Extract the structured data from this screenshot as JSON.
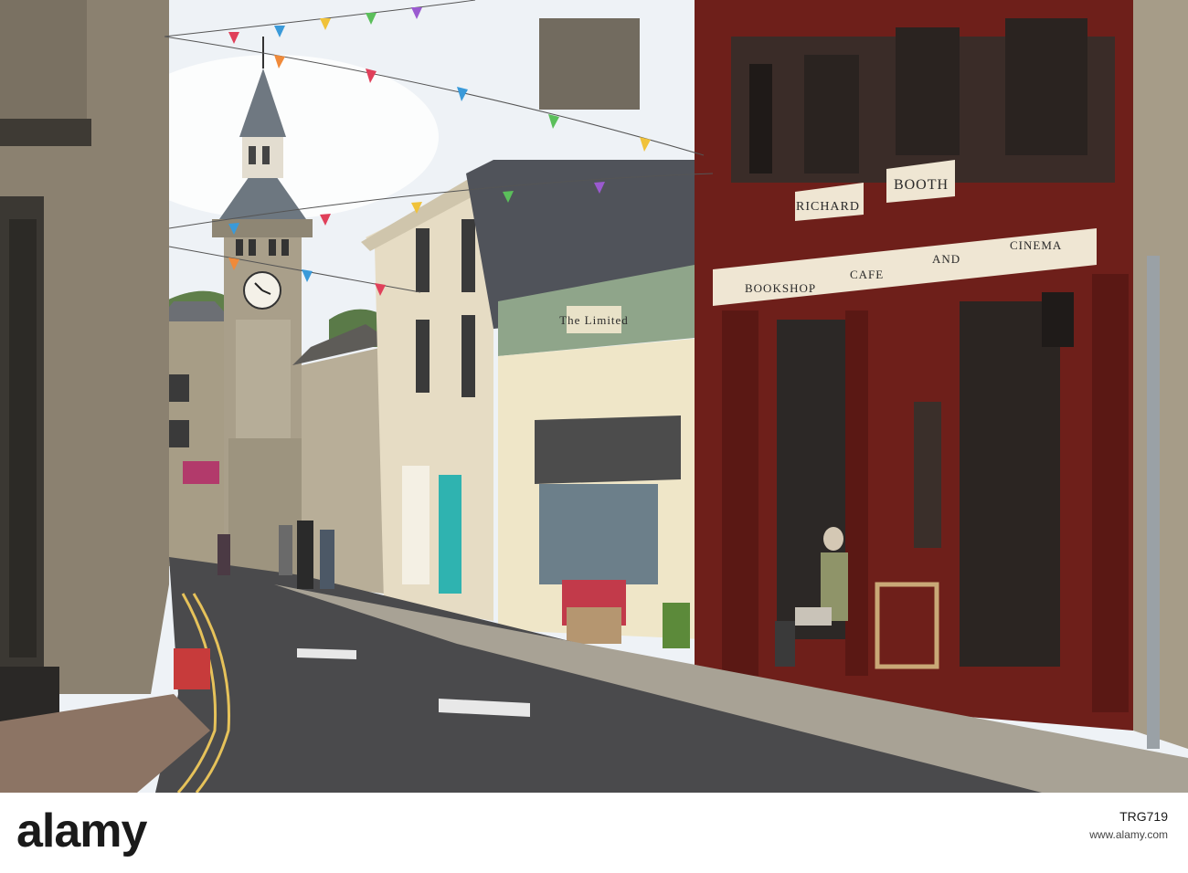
{
  "photo": {
    "signs": {
      "shop_name_1": "RICHARD",
      "shop_name_2": "BOOTH",
      "fascia_1": "BOOKSHOP",
      "fascia_2": "CAFE",
      "fascia_3": "AND",
      "fascia_4": "CINEMA",
      "neighbour_shop": "The Limited"
    },
    "colors": {
      "sky": "#eef2f6",
      "stone_dark": "#8b8170",
      "stone_light": "#e6dcc4",
      "timber_red": "#6e1f1a",
      "road": "#4a4a4c",
      "shopfront_cream": "#efe6c8",
      "shopfront_green": "#8fa58a"
    }
  },
  "watermark": {
    "logo": "alamy",
    "image_id": "TRG719",
    "site": "www.alamy.com"
  }
}
